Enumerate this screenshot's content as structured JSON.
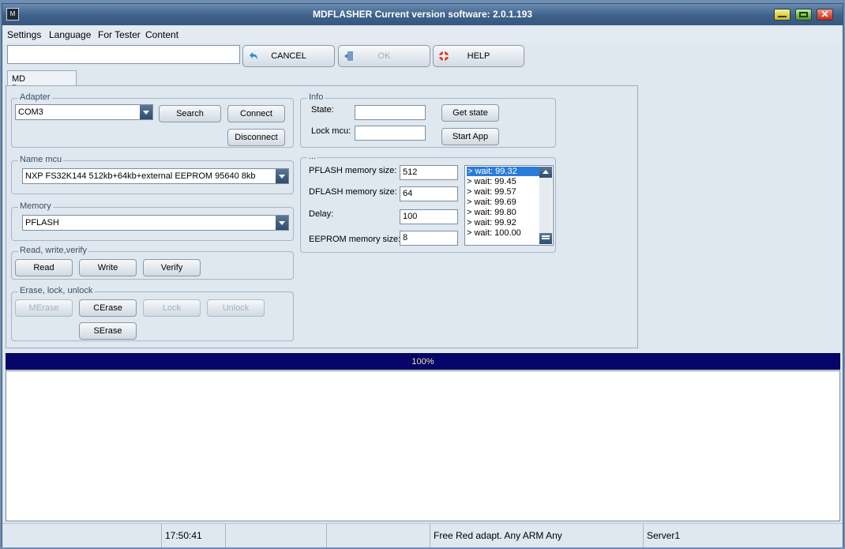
{
  "window": {
    "title": "MDFLASHER  Current version software: 2.0.1.193",
    "icon": "app-logo-icon",
    "controls": [
      "minimize-icon",
      "maximize-icon",
      "close-icon"
    ]
  },
  "menu": [
    "Settings",
    "Language",
    "For Tester",
    "Content"
  ],
  "toolbar": {
    "input_value": "",
    "cancel_label": "CANCEL",
    "ok_label": "OK",
    "help_label": "HELP",
    "icons": {
      "cancel": "undo-arrow-icon",
      "ok": "door-exit-icon",
      "help": "lifebuoy-icon"
    }
  },
  "tab": {
    "label": "MD Programmer"
  },
  "adapter": {
    "title": "Adapter",
    "port": "COM3",
    "search_label": "Search",
    "connect_label": "Connect",
    "disconnect_label": "Disconnect"
  },
  "name_mcu": {
    "title": "Name mcu",
    "selected": "NXP FS32K144 512kb+64kb+external EEPROM 95640 8kb"
  },
  "memory": {
    "title": "Memory",
    "selected": "PFLASH"
  },
  "rwv": {
    "title": "Read, write,verify",
    "read_label": "Read",
    "write_label": "Write",
    "verify_label": "Verify"
  },
  "erase": {
    "title": "Erase, lock, unlock",
    "merase_label": "MErase",
    "cerase_label": "CErase",
    "lock_label": "Lock",
    "unlock_label": "Unlock",
    "serase_label": "SErase"
  },
  "info": {
    "title": "Info",
    "state_label": "State:",
    "state_value": "",
    "lock_label": "Lock mcu:",
    "lock_value": "",
    "get_state_label": "Get state",
    "start_app_label": "Start App"
  },
  "sizes": {
    "title": "...",
    "pflash_label": "PFLASH memory size:",
    "pflash_value": "512",
    "dflash_label": "DFLASH memory size:",
    "dflash_value": "64",
    "delay_label": "Delay:",
    "delay_value": "100",
    "eeprom_label": "EEPROM memory size:",
    "eeprom_value": "8"
  },
  "log": [
    "> wait: 99.32",
    "> wait: 99.45",
    "> wait: 99.57",
    "> wait: 99.69",
    "> wait: 99.80",
    "> wait: 99.92",
    "> wait: 100.00"
  ],
  "progress": {
    "percent": 100,
    "label": "100%"
  },
  "status": {
    "cell1": "",
    "time": "17:50:41",
    "cell3": "",
    "cell4": "",
    "adapter_info": "Free Red adapt. Any ARM Any",
    "server": "Server1"
  },
  "colors": {
    "progress": "#05056b",
    "progress_text": "#f0e8a0",
    "selection": "#2b7cd8"
  }
}
